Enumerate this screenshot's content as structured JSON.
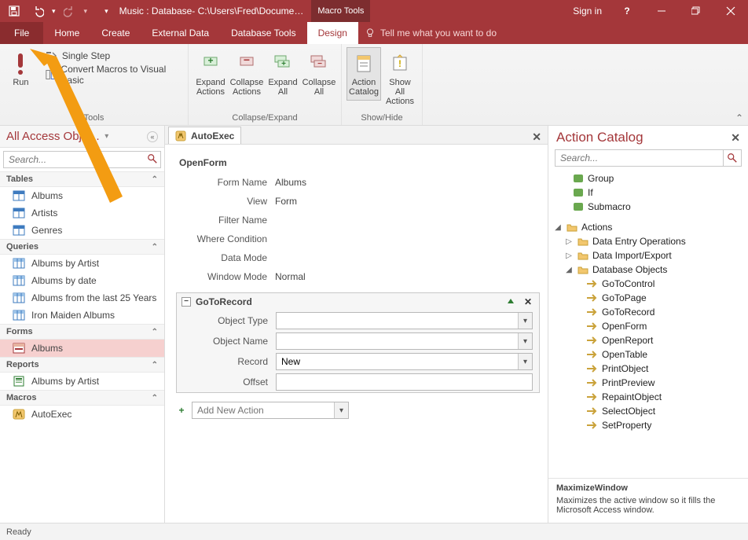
{
  "colors": {
    "brand": "#a4373a",
    "brand_dark": "#8a2c2e",
    "anno": "#f39c12"
  },
  "title": {
    "doc": "Music : Database- C:\\Users\\Fred\\Docume…",
    "contextual": "Macro Tools",
    "signin": "Sign in"
  },
  "qat": {
    "save": "Save",
    "undo": "Undo",
    "redo": "Redo",
    "customize": "Customize Quick Access Toolbar"
  },
  "tabs": {
    "file": "File",
    "home": "Home",
    "create": "Create",
    "external": "External Data",
    "dbtools": "Database Tools",
    "design": "Design",
    "tellme": "Tell me what you want to do"
  },
  "ribbon": {
    "tools_group": "Tools",
    "run": "Run",
    "single_step": "Single Step",
    "convert_vb": "Convert Macros to Visual Basic",
    "collapse_expand_group": "Collapse/Expand",
    "expand_actions_t": "Expand",
    "expand_actions_b": "Actions",
    "collapse_actions_t": "Collapse",
    "collapse_actions_b": "Actions",
    "expand_all_t": "Expand",
    "expand_all_b": "All",
    "collapse_all_t": "Collapse",
    "collapse_all_b": "All",
    "show_hide_group": "Show/Hide",
    "action_catalog_t": "Action",
    "action_catalog_b": "Catalog",
    "show_all_t": "Show All",
    "show_all_b": "Actions"
  },
  "nav": {
    "header": "All Access Obje…",
    "search_ph": "Search...",
    "groups": {
      "tables": "Tables",
      "queries": "Queries",
      "forms": "Forms",
      "reports": "Reports",
      "macros": "Macros"
    },
    "tables": [
      "Albums",
      "Artists",
      "Genres"
    ],
    "queries": [
      "Albums by Artist",
      "Albums by date",
      "Albums from the last 25 Years",
      "Iron Maiden Albums"
    ],
    "forms": [
      "Albums"
    ],
    "reports": [
      "Albums by Artist"
    ],
    "macros": [
      "AutoExec"
    ],
    "selected_form": "Albums"
  },
  "docTab": {
    "name": "AutoExec"
  },
  "macro": {
    "openform": {
      "hdr": "OpenForm",
      "rows": {
        "form_name_l": "Form Name",
        "form_name_v": "Albums",
        "view_l": "View",
        "view_v": "Form",
        "filter_l": "Filter Name",
        "filter_v": "",
        "where_l": "Where Condition",
        "where_v": "",
        "data_l": "Data Mode",
        "data_v": "",
        "window_l": "Window Mode",
        "window_v": "Normal"
      }
    },
    "gotorecord": {
      "hdr": "GoToRecord",
      "rows": {
        "objtype_l": "Object Type",
        "objtype_v": "",
        "objname_l": "Object Name",
        "objname_v": "",
        "record_l": "Record",
        "record_v": "New",
        "offset_l": "Offset",
        "offset_v": ""
      }
    },
    "add_new": "Add New Action"
  },
  "catalog": {
    "title": "Action Catalog",
    "search_ph": "Search...",
    "flow": {
      "group": "Group",
      "if": "If",
      "submacro": "Submacro"
    },
    "actions_label": "Actions",
    "cats": {
      "data_entry": "Data Entry Operations",
      "data_io": "Data Import/Export",
      "db_objects": "Database Objects"
    },
    "db_objects": [
      "GoToControl",
      "GoToPage",
      "GoToRecord",
      "OpenForm",
      "OpenReport",
      "OpenTable",
      "PrintObject",
      "PrintPreview",
      "RepaintObject",
      "SelectObject",
      "SetProperty"
    ],
    "help_name": "MaximizeWindow",
    "help_text": "Maximizes the active window so it fills the Microsoft Access window."
  },
  "status": {
    "ready": "Ready"
  }
}
